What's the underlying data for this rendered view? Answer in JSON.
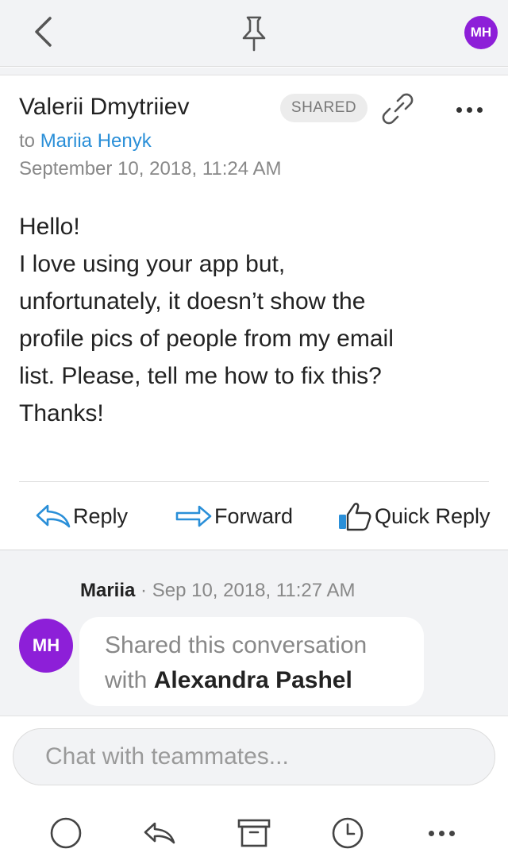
{
  "header": {
    "back_icon": "chevron-left-icon",
    "pin_icon": "pin-icon",
    "avatar_initials": "MH",
    "avatar_color": "#8d1fd8"
  },
  "message": {
    "sender": "Valerii Dmytriiev",
    "badge": "SHARED",
    "link_icon": "link-icon",
    "more_icon": "more-horizontal-icon",
    "to_prefix": "to",
    "to_name": "Mariia Henyk",
    "date": "September 10, 2018, 11:24 AM",
    "body_lines": [
      "Hello!",
      "I love using your app but,",
      "unfortunately, it doesn’t show the",
      "profile pics of people from my email",
      "list. Please, tell me how to fix this?",
      "Thanks!"
    ]
  },
  "actions": {
    "reply": "Reply",
    "forward": "Forward",
    "quick_reply": "Quick Reply",
    "accent_color": "#2a8fd8"
  },
  "activity": {
    "author": "Mariia",
    "separator": "·",
    "timestamp": "Sep 10, 2018, 11:27 AM",
    "avatar_initials": "MH",
    "text_prefix": "Shared this conversation",
    "text_with": "with",
    "target_name": "Alexandra Pashel"
  },
  "composer": {
    "placeholder": "Chat with teammates..."
  },
  "toolbar": {
    "items": [
      "done-circle-icon",
      "reply-icon",
      "archive-icon",
      "clock-icon",
      "more-horizontal-icon"
    ]
  }
}
